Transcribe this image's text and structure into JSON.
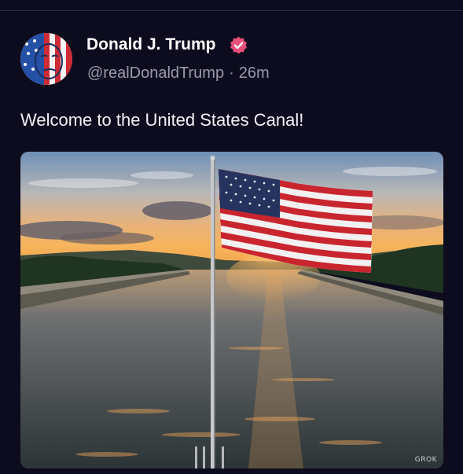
{
  "post": {
    "author_name": "Donald J. Trump",
    "handle": "@realDonaldTrump",
    "separator": "·",
    "time_ago": "26m",
    "text": "Welcome to the United States Canal!",
    "watermark": "GROK"
  },
  "icons": {
    "verified": "verified-badge-icon",
    "avatar": "profile-avatar"
  },
  "colors": {
    "background": "#0d0c1e",
    "verified_badge": "#e8507a",
    "handle_text": "#9b9aad"
  }
}
